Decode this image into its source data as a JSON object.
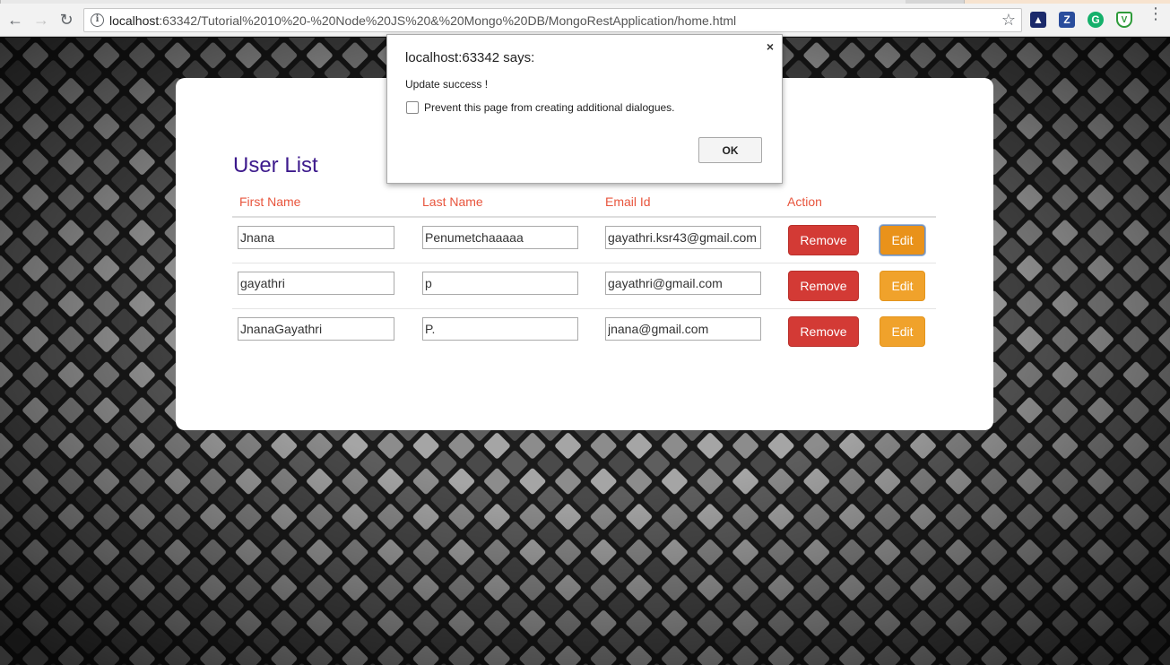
{
  "browser": {
    "url_host": "localhost",
    "url_rest": ":63342/Tutorial%2010%20-%20Node%20JS%20&%20Mongo%20DB/MongoRestApplication/home.html",
    "extensions": [
      "Z",
      "G",
      "V"
    ]
  },
  "page": {
    "title": "User List",
    "columns": [
      "First Name",
      "Last Name",
      "Email Id",
      "Action"
    ],
    "rows": [
      {
        "first": "Jnana",
        "last": "Penumetchaaaaa",
        "email": "gayathri.ksr43@gmail.com"
      },
      {
        "first": "gayathri",
        "last": "p",
        "email": "gayathri@gmail.com"
      },
      {
        "first": "JnanaGayathri",
        "last": "P.",
        "email": "jnana@gmail.com"
      }
    ],
    "remove_label": "Remove",
    "edit_label": "Edit"
  },
  "dialog": {
    "origin": "localhost:63342 says:",
    "message": "Update success !",
    "checkbox_label": "Prevent this page from creating additional dialogues.",
    "ok_label": "OK",
    "close_glyph": "×"
  },
  "colors": {
    "title": "#3d1a8c",
    "header": "#e8553d",
    "remove": "#d33a35",
    "edit": "#f0a22b"
  }
}
